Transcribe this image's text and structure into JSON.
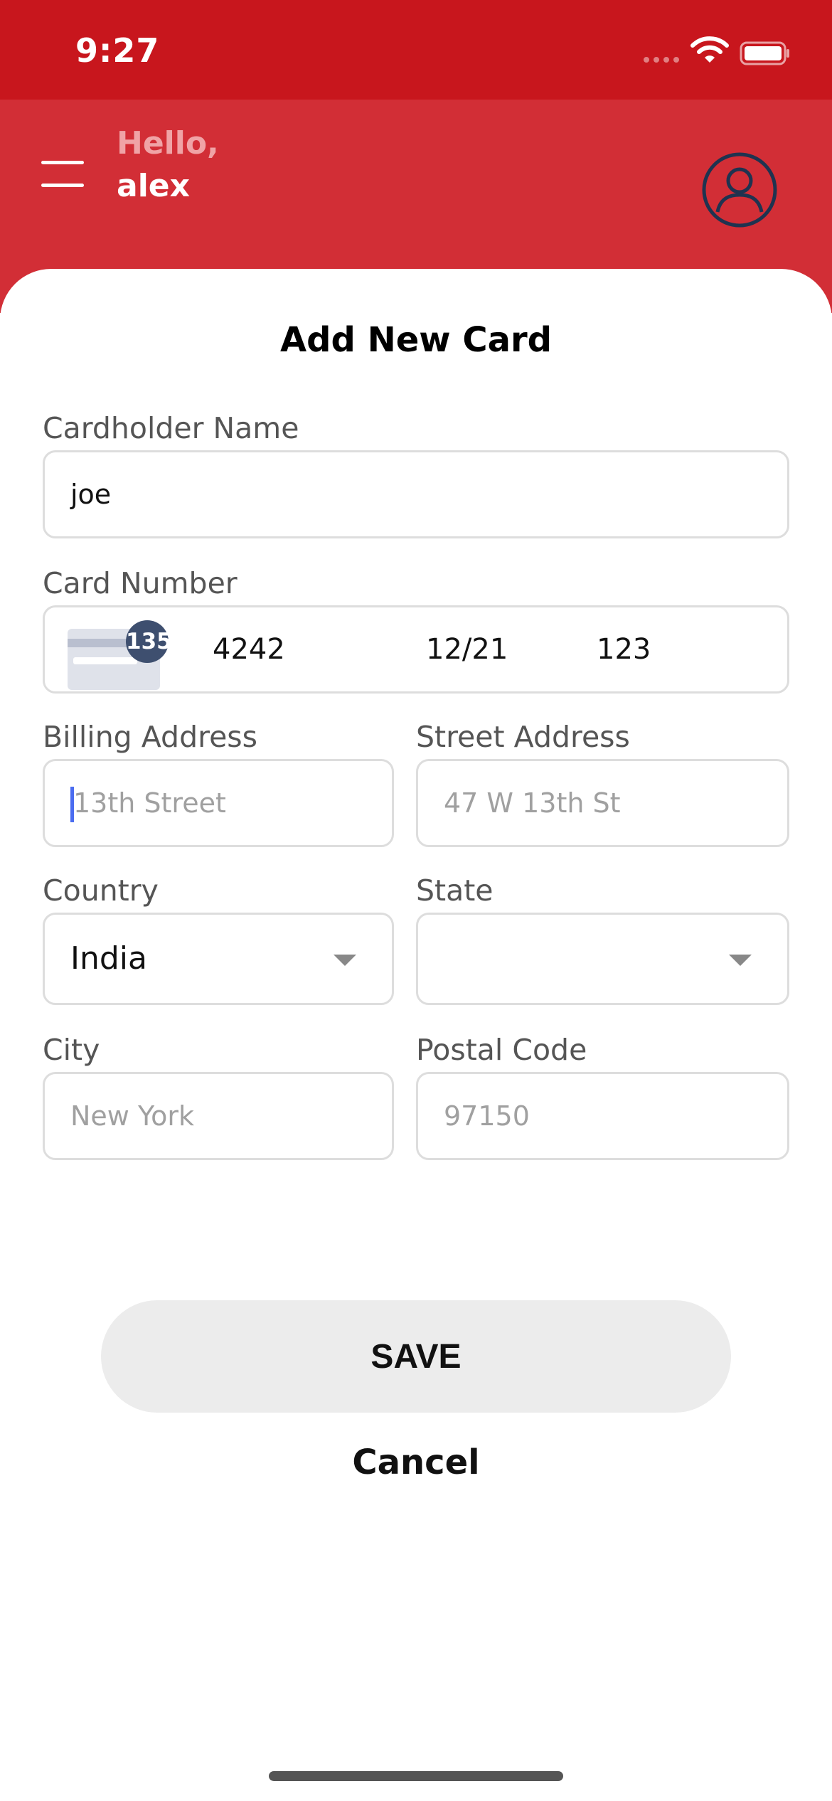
{
  "status_bar": {
    "time": "9:27",
    "wifi_icon": "wifi-icon",
    "battery_icon": "battery-icon"
  },
  "header": {
    "menu_icon": "hamburger-menu-icon",
    "greeting": "Hello,",
    "user_name": "alex",
    "avatar_icon": "user-avatar-icon",
    "background_color": "#d22e36"
  },
  "form": {
    "title": "Add New Card",
    "cardholder_name": {
      "label": "Cardholder Name",
      "value": "joe"
    },
    "card_number": {
      "label": "Card Number",
      "card_icon": "credit-card-icon",
      "badge": "135",
      "number": "4242",
      "expiry": "12/21",
      "cvc": "123"
    },
    "billing_address": {
      "label": "Billing Address",
      "placeholder": "13th Street"
    },
    "street_address": {
      "label": "Street Address",
      "placeholder": "47 W 13th St"
    },
    "country": {
      "label": "Country",
      "value": "India"
    },
    "state": {
      "label": "State",
      "value": ""
    },
    "city": {
      "label": "City",
      "placeholder": "New York"
    },
    "postal_code": {
      "label": "Postal Code",
      "placeholder": "97150"
    }
  },
  "actions": {
    "save_label": "SAVE",
    "cancel_label": "Cancel"
  },
  "colors": {
    "status_bar": "#c8161d",
    "header": "#d22e36",
    "caret": "#4a6cf0"
  }
}
